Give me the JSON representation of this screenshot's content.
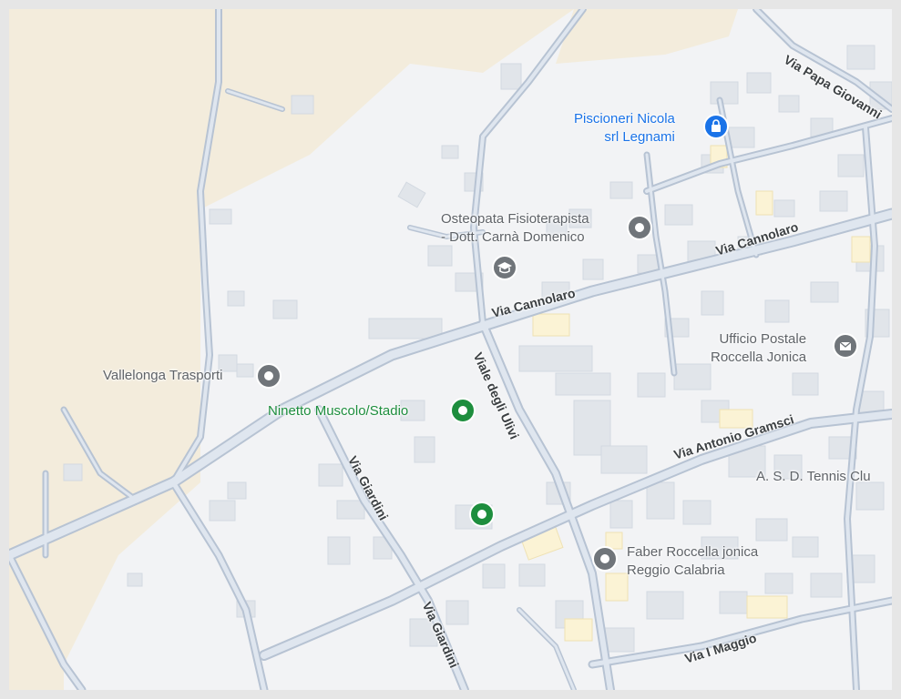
{
  "map": {
    "pois": {
      "piscioneri": {
        "line1": "Piscioneri Nicola",
        "line2": "srl Legnami",
        "icon": "shopping-bag-icon",
        "color": "#1a73e8"
      },
      "osteopata": {
        "line1": "Osteopata Fisioterapista",
        "line2": "- Dott. Carnà Domenico",
        "icon": "map-pin-icon"
      },
      "vallelonga": {
        "label": "Vallelonga Trasporti",
        "icon": "map-pin-icon"
      },
      "ninetto": {
        "label": "Ninetto Muscolo/Stadio",
        "icon": "stadium-pin-icon",
        "color": "#1e8e3e"
      },
      "ufficio": {
        "line1": "Ufficio Postale",
        "line2": "Roccella Jonica",
        "icon": "mail-icon"
      },
      "tennis": {
        "label": "A. S. D. Tennis Clu"
      },
      "faber": {
        "line1": "Faber Roccella jonica",
        "line2": "Reggio Calabria",
        "icon": "map-pin-icon"
      }
    },
    "streets": {
      "via_cannolaro_1": "Via Cannolaro",
      "via_cannolaro_2": "Via Cannolaro",
      "viale_degli_ulivi": "Viale degli Ulivi",
      "via_giardini_1": "Via Giardini",
      "via_giardini_2": "Via Giardini",
      "via_antonio_gramsci": "Via Antonio Gramsci",
      "via_papa_giovanni": "Via Papa Giovanni",
      "via_i_maggio": "Via I Maggio"
    },
    "colors": {
      "terrain": "#f3ecdc",
      "land": "#f2f3f5",
      "road_fill": "#dfe6ef",
      "road_casing": "#b7c3d3",
      "building": "#e1e5ea",
      "highlight_building": "#fbf3d5"
    }
  }
}
